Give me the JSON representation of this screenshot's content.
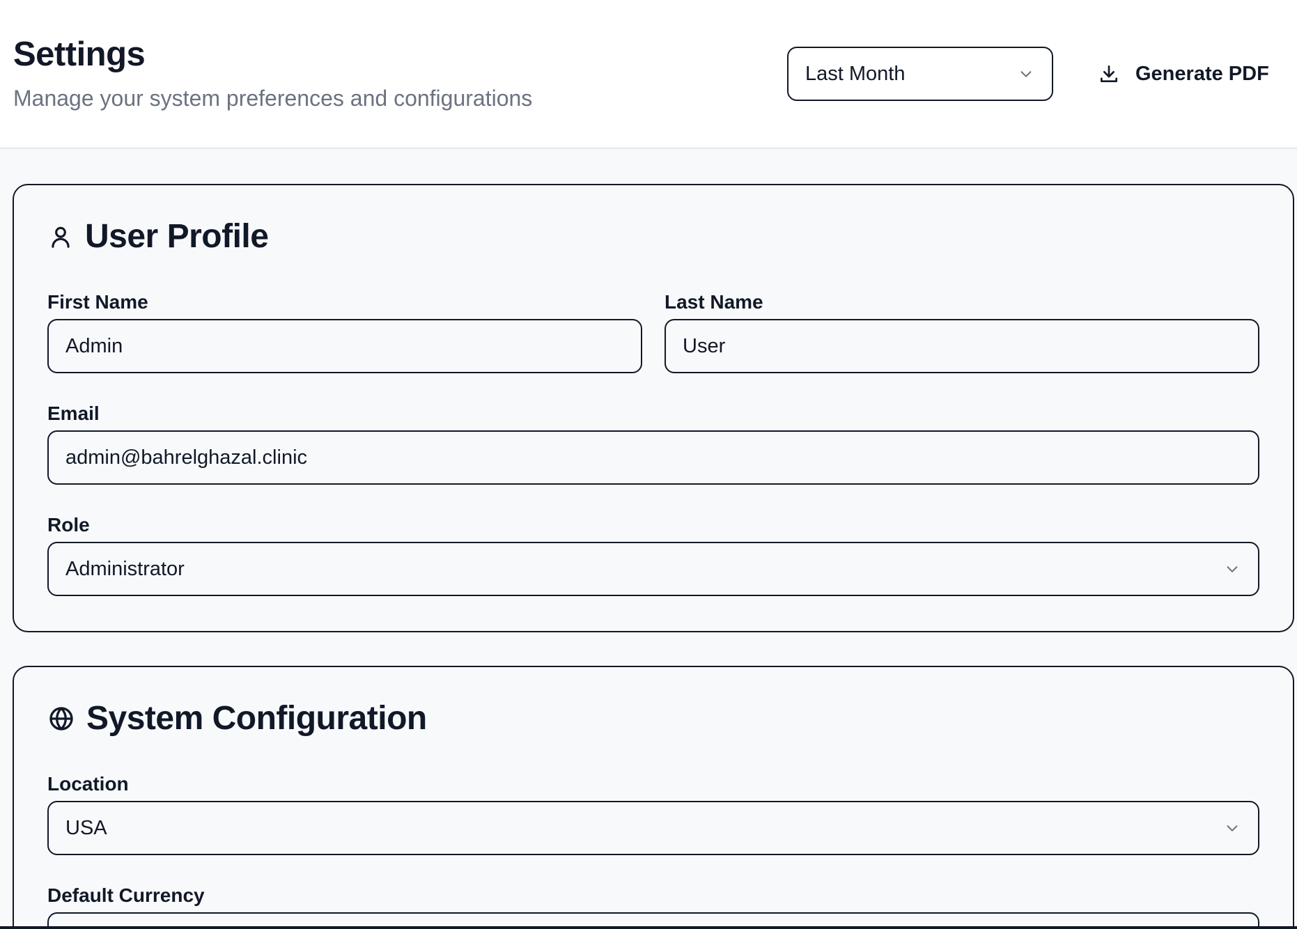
{
  "header": {
    "title": "Settings",
    "subtitle": "Manage your system preferences and configurations",
    "period_select": {
      "value": "Last Month",
      "icon": "chevron-down-icon"
    },
    "pdf_button": {
      "label": "Generate PDF",
      "icon": "download-icon"
    }
  },
  "profile": {
    "title": "User Profile",
    "icon": "user-icon",
    "first_name": {
      "label": "First Name",
      "value": "Admin"
    },
    "last_name": {
      "label": "Last Name",
      "value": "User"
    },
    "email": {
      "label": "Email",
      "value": "admin@bahrelghazal.clinic"
    },
    "role": {
      "label": "Role",
      "value": "Administrator"
    }
  },
  "system": {
    "title": "System Configuration",
    "icon": "globe-icon",
    "location": {
      "label": "Location",
      "value": "USA"
    },
    "currency": {
      "label": "Default Currency"
    }
  },
  "colors": {
    "text": "#111827",
    "muted": "#6b7280",
    "border": "#111827",
    "background": "#f8f9fb",
    "header_bg": "#ffffff"
  }
}
